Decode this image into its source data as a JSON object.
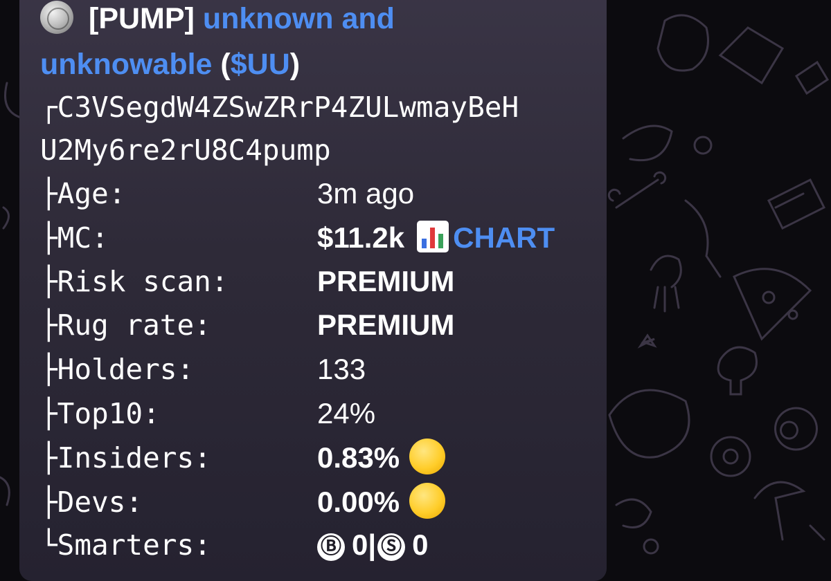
{
  "message": {
    "tag": "[PUMP]",
    "token_name_line1": "unknown and",
    "token_name_line2": "unknowable",
    "ticker_open": "(",
    "ticker": "$UU",
    "ticker_close": ")",
    "address_line1": "┌C3VSegdW4ZSwZRrP4ZULwmayBeH",
    "address_line2": "U2My6re2rU8C4pump",
    "rows": [
      {
        "label": "├Age:",
        "value": "3m ago"
      },
      {
        "label": "├MC:",
        "value": "$11.2k",
        "link": "CHART"
      },
      {
        "label": "├Risk scan:",
        "value": "PREMIUM"
      },
      {
        "label": "├Rug rate:",
        "value": "PREMIUM"
      },
      {
        "label": "├Holders:",
        "value": "133"
      },
      {
        "label": "├Top10:",
        "value": "24%"
      },
      {
        "label": "├Insiders:",
        "value": "0.83%"
      },
      {
        "label": "├Devs:",
        "value": "0.00%"
      },
      {
        "label": "└Smarters:",
        "value_b_icon": "Ⓑ",
        "value_b": "0",
        "separator": "|",
        "value_s_icon": "Ⓢ",
        "value_s": "0"
      }
    ]
  },
  "icons": {
    "coin": "coin-icon",
    "chart": "bar-chart-icon",
    "status_dot": "yellow-circle-icon"
  },
  "colors": {
    "link": "#4e8ef2",
    "bubble": "#2e2a38",
    "background": "#0c0b0f",
    "status_yellow": "#ffcd2a"
  }
}
